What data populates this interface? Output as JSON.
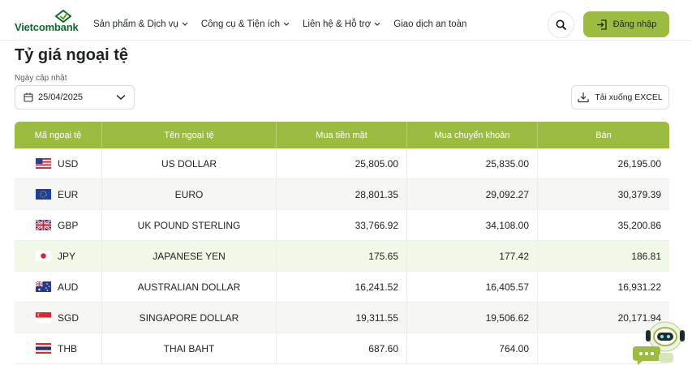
{
  "brand": {
    "name": "Vietcombank"
  },
  "nav": {
    "items": [
      {
        "label": "Sản phẩm & Dịch vụ",
        "has_dropdown": true
      },
      {
        "label": "Công cụ & Tiện ích",
        "has_dropdown": true
      },
      {
        "label": "Liên hệ & Hỗ trợ",
        "has_dropdown": true
      },
      {
        "label": "Giao dịch an toàn",
        "has_dropdown": false
      }
    ],
    "login_label": "Đăng nhập"
  },
  "page": {
    "title": "Tỷ giá ngoại tệ",
    "date_label": "Ngày cập nhật",
    "date_value": "25/04/2025",
    "download_label": "Tải xuống EXCEL"
  },
  "table": {
    "headers": [
      "Mã ngoại tệ",
      "Tên ngoại tệ",
      "Mua tiền mặt",
      "Mua chuyển khoản",
      "Bán"
    ],
    "rows": [
      {
        "code": "USD",
        "name": "US DOLLAR",
        "cash_buy": "25,805.00",
        "transfer_buy": "25,835.00",
        "sell": "26,195.00",
        "flag": "us-flag"
      },
      {
        "code": "EUR",
        "name": "EURO",
        "cash_buy": "28,801.35",
        "transfer_buy": "29,092.27",
        "sell": "30,379.39",
        "flag": "eu-flag"
      },
      {
        "code": "GBP",
        "name": "UK POUND STERLING",
        "cash_buy": "33,766.92",
        "transfer_buy": "34,108.00",
        "sell": "35,200.86",
        "flag": "uk-flag"
      },
      {
        "code": "JPY",
        "name": "JAPANESE YEN",
        "cash_buy": "175.65",
        "transfer_buy": "177.42",
        "sell": "186.81",
        "flag": "jp-flag"
      },
      {
        "code": "AUD",
        "name": "AUSTRALIAN DOLLAR",
        "cash_buy": "16,241.52",
        "transfer_buy": "16,405.57",
        "sell": "16,931.22",
        "flag": "au-flag"
      },
      {
        "code": "SGD",
        "name": "SINGAPORE DOLLAR",
        "cash_buy": "19,311.55",
        "transfer_buy": "19,506.62",
        "sell": "20,171.94",
        "flag": "sg-flag"
      },
      {
        "code": "THB",
        "name": "THAI BAHT",
        "cash_buy": "687.60",
        "transfer_buy": "764.00",
        "sell": "",
        "flag": "th-flag"
      }
    ]
  },
  "colors": {
    "accent": "#9cbc41",
    "brand_green": "#0f6b2f",
    "row_alt": "#f6f7f5",
    "row_highlight": "#f2f8e8"
  }
}
